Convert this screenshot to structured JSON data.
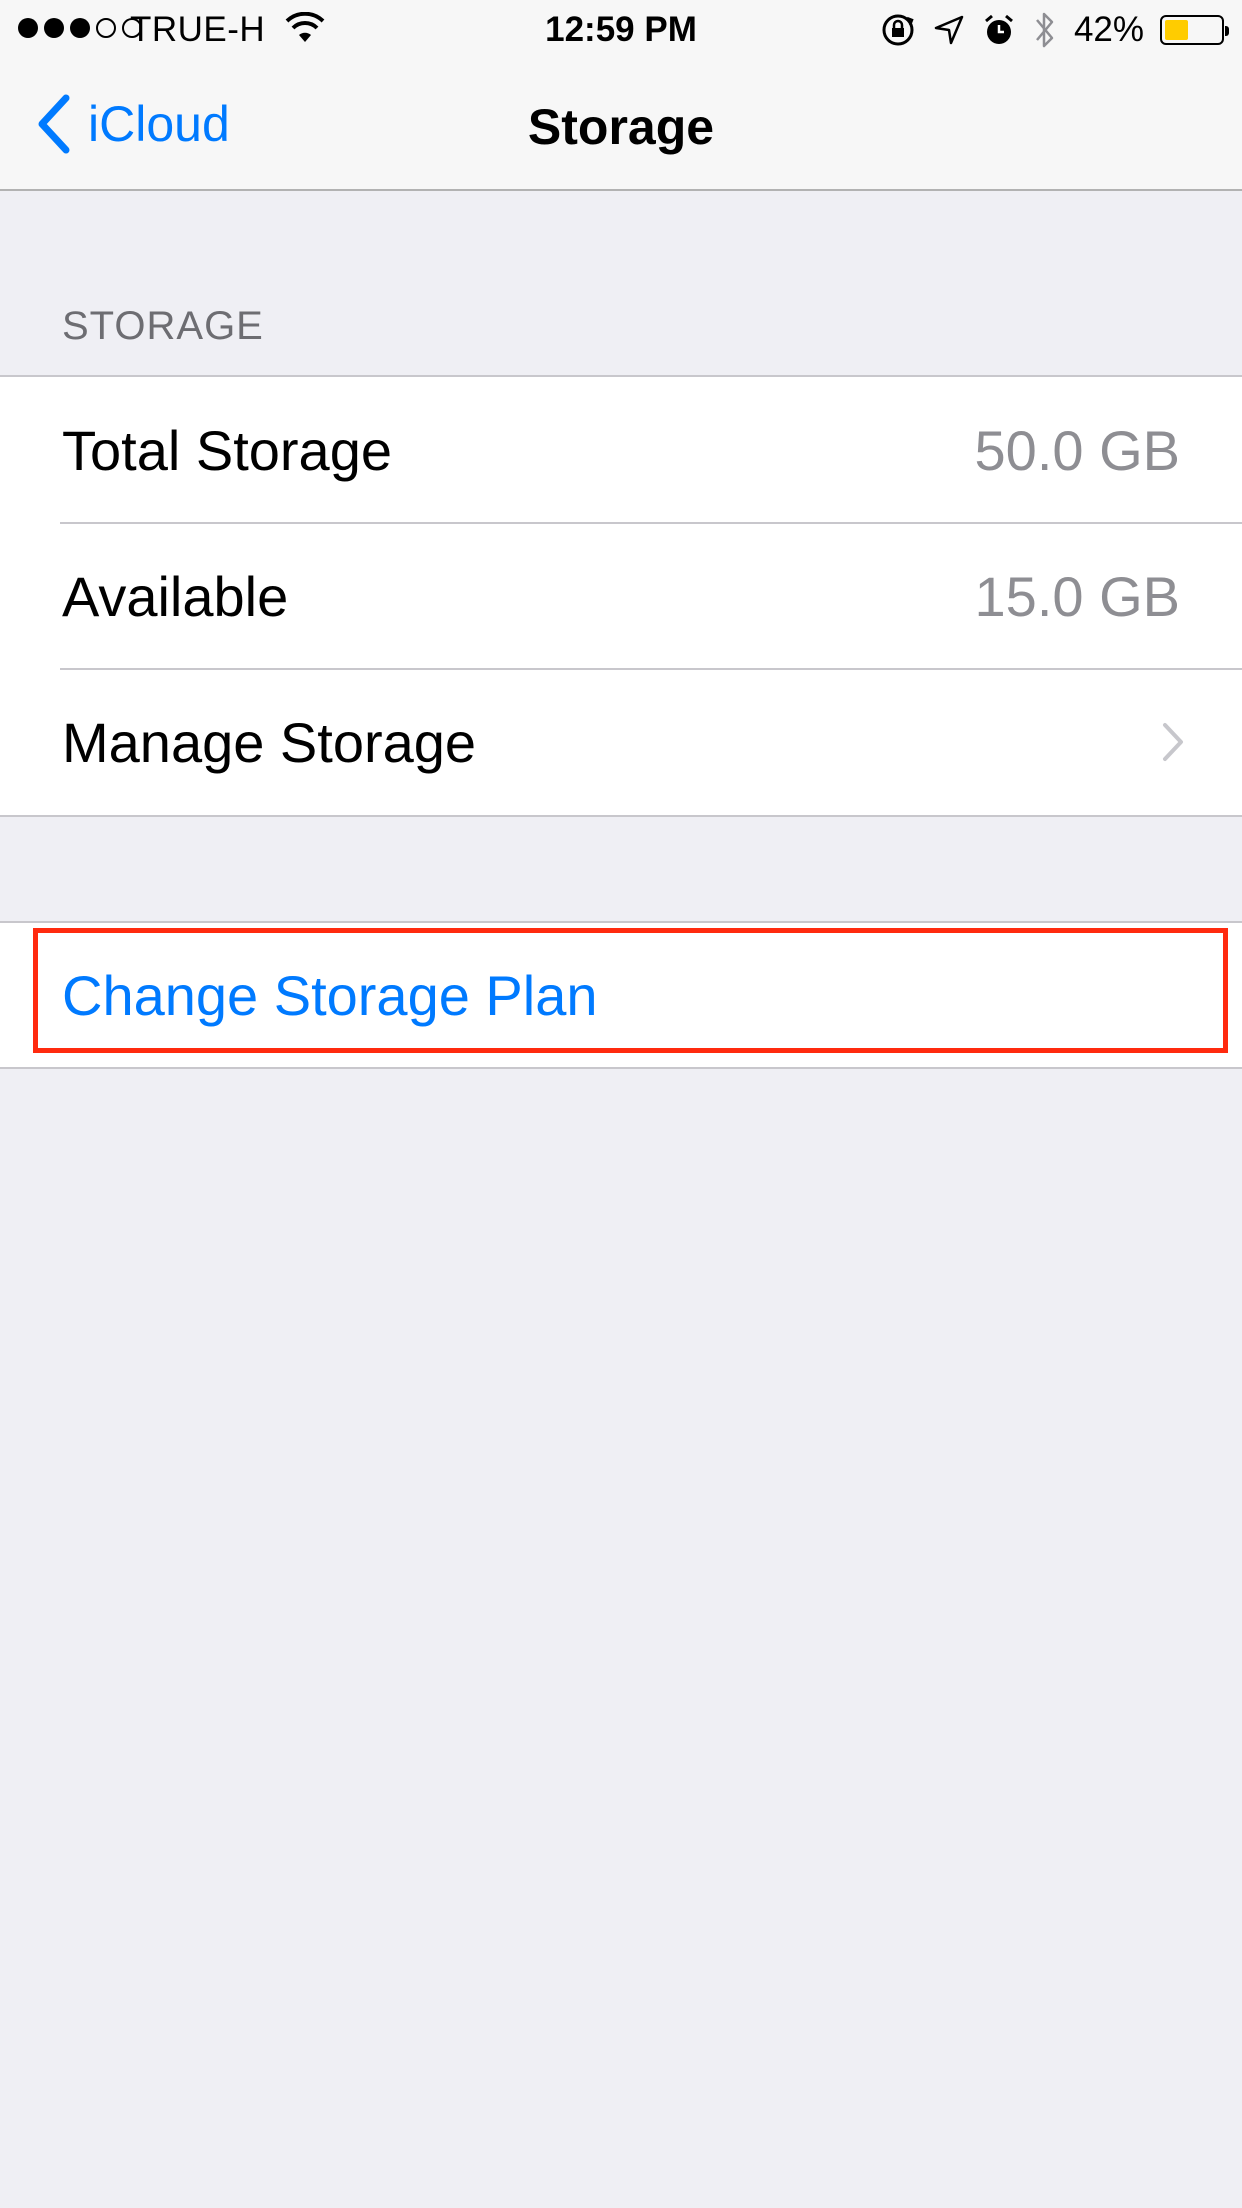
{
  "status_bar": {
    "carrier": "TRUE-H",
    "time": "12:59 PM",
    "battery_percent": "42%",
    "battery_level": 0.42,
    "signal_bars_filled": 3,
    "signal_bars_total": 5
  },
  "nav": {
    "back_label": "iCloud",
    "title": "Storage"
  },
  "storage_section": {
    "header": "STORAGE",
    "rows": [
      {
        "label": "Total Storage",
        "value": "50.0 GB"
      },
      {
        "label": "Available",
        "value": "15.0 GB"
      },
      {
        "label": "Manage Storage"
      }
    ]
  },
  "plan_section": {
    "link_label": "Change Storage Plan"
  },
  "colors": {
    "accent": "#007aff",
    "highlight": "#ff2a0f",
    "background": "#efeff4",
    "battery": "#ffcc00"
  },
  "icons": [
    "chevron-left-icon",
    "wifi-icon",
    "orientation-lock-icon",
    "location-arrow-icon",
    "alarm-clock-icon",
    "bluetooth-icon",
    "battery-icon",
    "chevron-right-icon"
  ]
}
